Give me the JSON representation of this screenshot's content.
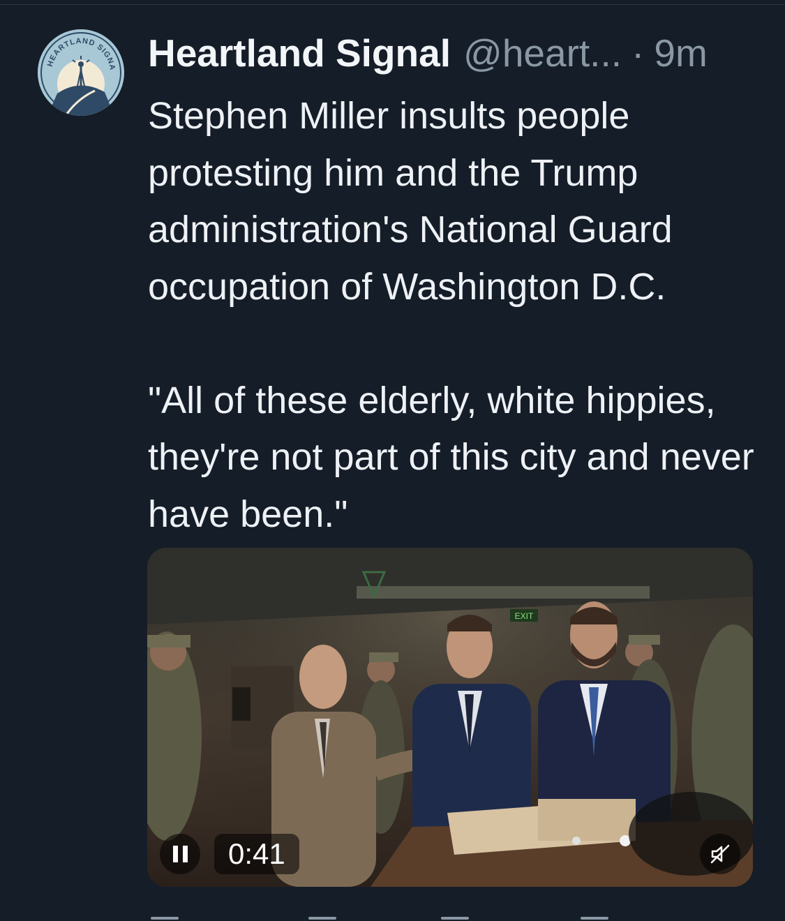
{
  "tweet": {
    "display_name": "Heartland Signal",
    "handle": "@heart...",
    "separator": "·",
    "time": "9m",
    "text": "Stephen Miller insults people protesting him and the Trump administration's National Guard occupation of Washington D.C.\n\n\"All of these elderly, white hippies, they're not part of this city and never have been.\""
  },
  "avatar": {
    "logo_text": "HEARTLAND SIGNAL",
    "icon": "radio-tower-logo"
  },
  "video": {
    "duration": "0:41",
    "exit_sign": "EXIT",
    "state": "playing",
    "pause_icon": "pause-icon",
    "mute_icon": "muted-speaker-icon"
  },
  "colors": {
    "background": "#151d28",
    "text": "#eef1f5",
    "muted": "#8a97a5"
  }
}
